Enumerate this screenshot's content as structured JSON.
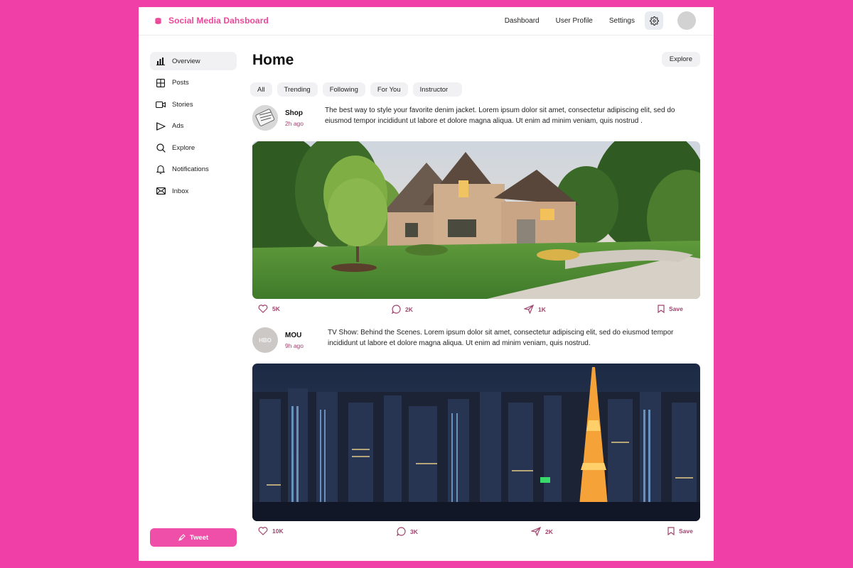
{
  "app": {
    "title": "Social Media Dahsboard",
    "accent_color": "#EC4899",
    "background_color": "#F03FA7"
  },
  "topnav": {
    "links": [
      "Dashboard",
      "User Profile",
      "Settings"
    ],
    "settings_icon": "gear-icon"
  },
  "sidebar": {
    "items": [
      {
        "label": "Overview",
        "icon": "bar-chart-icon",
        "active": true
      },
      {
        "label": "Posts",
        "icon": "grid-icon",
        "active": false
      },
      {
        "label": "Stories",
        "icon": "video-icon",
        "active": false
      },
      {
        "label": "Ads",
        "icon": "megaphone-icon",
        "active": false
      },
      {
        "label": "Explore",
        "icon": "search-icon",
        "active": false
      },
      {
        "label": "Notifications",
        "icon": "bell-icon",
        "active": false
      },
      {
        "label": "Inbox",
        "icon": "mail-icon",
        "active": false
      }
    ],
    "tweet_label": "Tweet"
  },
  "main": {
    "title": "Home",
    "explore_label": "Explore",
    "filters": [
      "All",
      "Trending",
      "Following",
      "For You",
      "Instructor"
    ]
  },
  "posts": [
    {
      "author": "Shop",
      "time": "2h ago",
      "text": "The best way to style your favorite denim jacket. Lorem ipsum dolor sit amet, consectetur adipiscing elit, sed do eiusmod  tempor incididunt ut labore et dolore magna aliqua. Ut enim ad minim  veniam, quis nostrud .",
      "image": "suburban house with lawn and driveway",
      "likes": "5K",
      "comments": "2K",
      "shares": "1K",
      "save_label": "Save"
    },
    {
      "author": "MOU",
      "avatar_text": "HBO",
      "time": "9h ago",
      "text": "TV Show: Behind the Scenes. Lorem ipsum dolor sit amet, consectetur adipiscing elit, sed do eiusmod  tempor incididunt ut labore et dolore magna aliqua. Ut enim ad minim  veniam, quis nostrud.",
      "image": "night city skyline with illuminated tower",
      "likes": "10K",
      "comments": "3K",
      "shares": "2K",
      "save_label": "Save"
    }
  ]
}
